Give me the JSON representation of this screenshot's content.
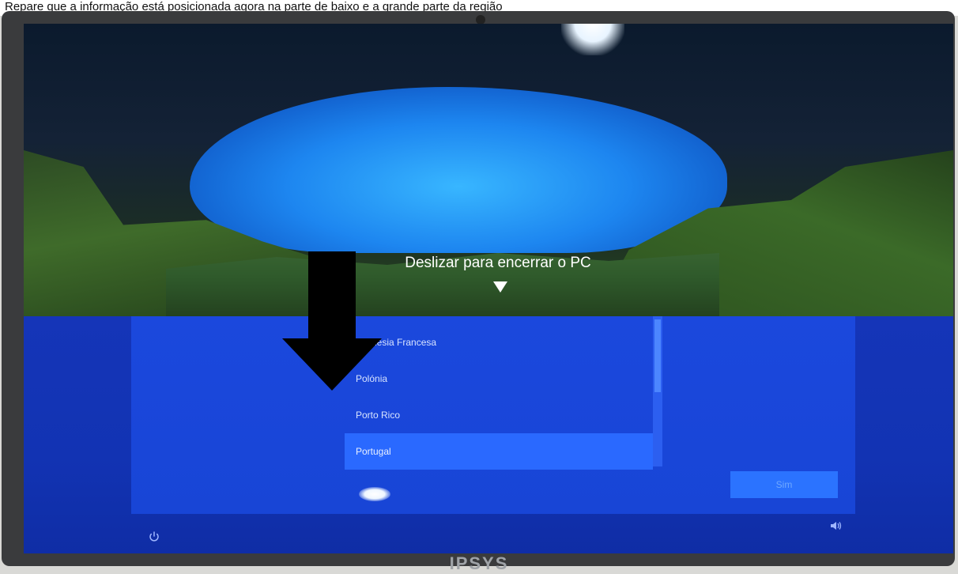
{
  "photo": {
    "caption": "Repare que a informação está posicionada agora na parte de baixo e a grande parte da região"
  },
  "monitor": {
    "brand": "IPSYS"
  },
  "lock_screen": {
    "slide_text": "Deslizar para encerrar o PC"
  },
  "oobe": {
    "region_list": [
      {
        "label": "Polinésia Francesa",
        "selected": false
      },
      {
        "label": "Polónia",
        "selected": false
      },
      {
        "label": "Porto Rico",
        "selected": false
      },
      {
        "label": "Portugal",
        "selected": true
      }
    ],
    "yes_button_label": "Sim"
  },
  "colors": {
    "oobe_blue": "#1845d6",
    "selection_blue": "#2a69ff",
    "annotation_arrow": "#000000"
  },
  "icons": {
    "power": "power-icon",
    "volume": "volume-icon",
    "annotation": "down-arrow-icon"
  }
}
